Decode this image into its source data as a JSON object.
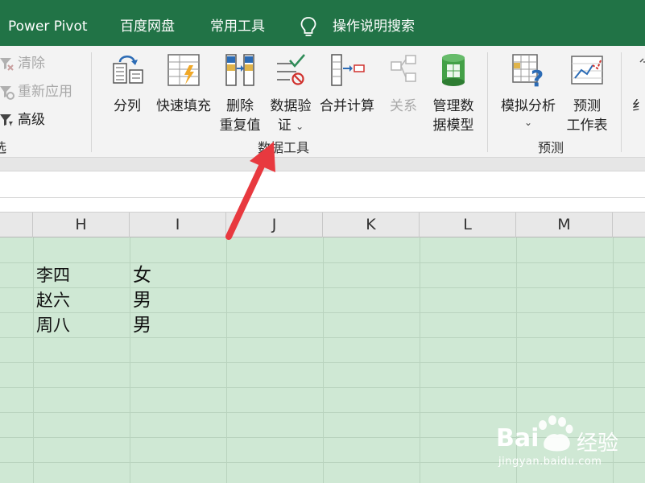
{
  "tabs": {
    "items": [
      "Power Pivot",
      "百度网盘",
      "常用工具",
      "操作说明搜索"
    ]
  },
  "ribbon": {
    "sort_filter": {
      "items": [
        "清除",
        "重新应用",
        "高级"
      ],
      "group_label_partial": "选"
    },
    "data_tools": {
      "group_label": "数据工具",
      "buttons": {
        "split": "分列",
        "flash_fill": "快速填充",
        "remove_dup_1": "删除",
        "remove_dup_2": "重复值",
        "validation_1": "数据验",
        "validation_2": "证",
        "consolidate": "合并计算",
        "relations": "关系",
        "data_model_1": "管理数",
        "data_model_2": "据模型"
      }
    },
    "forecast": {
      "group_label": "预测",
      "buttons": {
        "whatif": "模拟分析",
        "sheet_1": "预测",
        "sheet_2": "工作表"
      }
    },
    "partial_next": "纟"
  },
  "columns": [
    "H",
    "I",
    "J",
    "K",
    "L",
    "M"
  ],
  "rows": [
    {
      "name": "李四",
      "gender": "女"
    },
    {
      "name": "赵六",
      "gender": "男"
    },
    {
      "name": "周八",
      "gender": "男"
    }
  ],
  "watermark": {
    "brand": "Bai",
    "brand2": "经验",
    "url": "jingyan.baidu.com"
  },
  "colors": {
    "tab_green": "#217346",
    "grid_green": "#cfe8d4",
    "arrow_red": "#e8393f"
  }
}
